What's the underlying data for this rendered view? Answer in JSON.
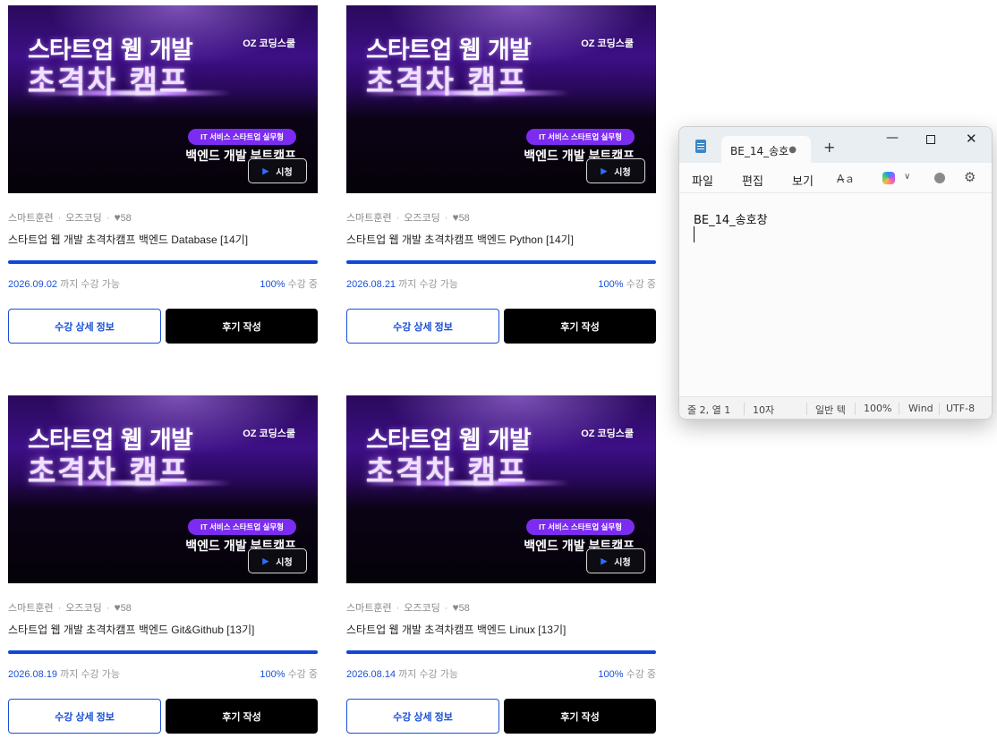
{
  "banner": {
    "line1": "스타트업 웹 개발",
    "line2": "초격차 캠프",
    "brand": "OZ 코딩스쿨",
    "pill": "IT 서비스 스타트업 실무형",
    "subtitle": "백엔드 개발 부트캠프",
    "watch_label": "시청"
  },
  "courses": [
    {
      "category": "스마트훈련",
      "provider": "오즈코딩",
      "likes": "58",
      "title": "스타트업 웹 개발 초격차캠프 백엔드 Database [14기]",
      "progress": 1.0,
      "due_date": "2026.09.02",
      "due_suffix": " 까지 수강 가능",
      "percent": "100%",
      "status": " 수강 중",
      "detail_label": "수강 상세 정보",
      "review_label": "후기 작성"
    },
    {
      "category": "스마트훈련",
      "provider": "오즈코딩",
      "likes": "58",
      "title": "스타트업 웹 개발 초격차캠프 백엔드 Python [14기]",
      "progress": 1.0,
      "due_date": "2026.08.21",
      "due_suffix": " 까지 수강 가능",
      "percent": "100%",
      "status": " 수강 중",
      "detail_label": "수강 상세 정보",
      "review_label": "후기 작성"
    },
    {
      "category": "스마트훈련",
      "provider": "오즈코딩",
      "likes": "58",
      "title": "스타트업 웹 개발 초격차캠프 백엔드 Git&Github [13기]",
      "progress": 1.0,
      "due_date": "2026.08.19",
      "due_suffix": " 까지 수강 가능",
      "percent": "100%",
      "status": " 수강 중",
      "detail_label": "수강 상세 정보",
      "review_label": "후기 작성"
    },
    {
      "category": "스마트훈련",
      "provider": "오즈코딩",
      "likes": "58",
      "title": "스타트업 웹 개발 초격차캠프 백엔드 Linux [13기]",
      "progress": 1.0,
      "due_date": "2026.08.14",
      "due_suffix": " 까지 수강 가능",
      "percent": "100%",
      "status": " 수강 중",
      "detail_label": "수강 상세 정보",
      "review_label": "후기 작성"
    }
  ],
  "notepad": {
    "tab_title": "BE_14_송호",
    "new_tab": "+",
    "menu": {
      "file": "파일",
      "edit": "편집",
      "view": "보기"
    },
    "content": "BE_14_송호창",
    "status": {
      "position": "줄 2, 열 1",
      "chars": "10자",
      "mode": "일반 텍",
      "zoom": "100%",
      "line_ending": "Wind",
      "encoding": "UTF-8"
    }
  },
  "colors": {
    "accent_blue": "#1a4fd6",
    "button_dark": "#000000",
    "banner_purple": "#7b2cf0"
  },
  "icons": [
    "heart-icon",
    "play-icon",
    "notepad-app-icon",
    "minimize-icon",
    "maximize-icon",
    "close-icon",
    "format-icon",
    "copilot-icon",
    "chevron-down-icon",
    "profile-icon",
    "settings-gear-icon"
  ]
}
